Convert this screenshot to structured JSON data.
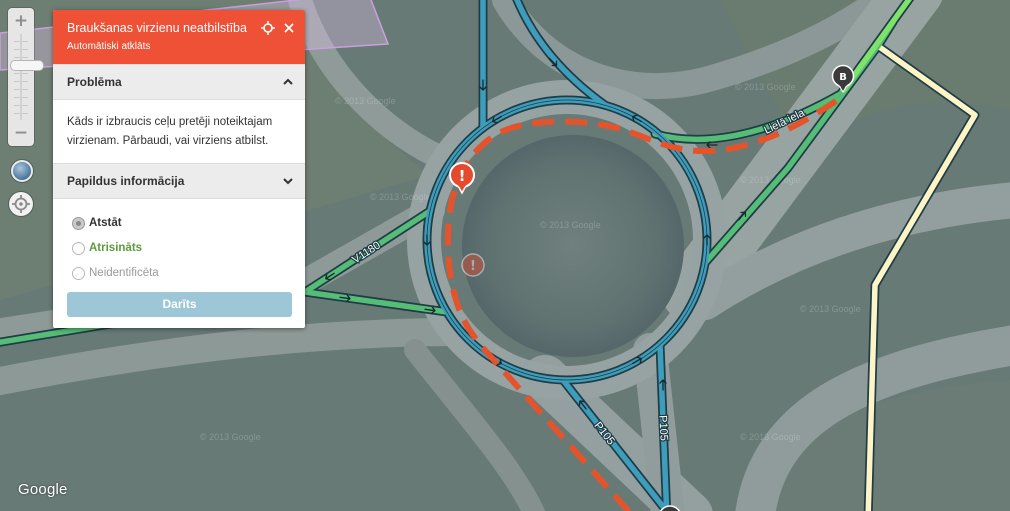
{
  "colors": {
    "panel_header": "#ee5136",
    "section_header_bg": "#ececec",
    "done_button": "#9dc7d6",
    "street_blue": "#3d9dbb",
    "highway_green": "#56bd77",
    "selected_green": "#7fe36b",
    "private_road_cream": "#fff4c6",
    "route_red": "#e3542c",
    "venue_purple": "#c9a0dc"
  },
  "map": {
    "google_logo": "Google",
    "imagery_watermark": "© 2013 Google",
    "road_labels": {
      "v1180": "V1180",
      "liela_iela": "Lielā iela",
      "p105_diagonal": "P105",
      "p105_vertical": "P105"
    },
    "markers": {
      "problem_glyph": "!",
      "end_point": "B"
    }
  },
  "zoom_control": {
    "zoom_in": "+",
    "zoom_out": "−",
    "zoom_level_fraction": 0.64,
    "layer_icon": "layers-globe-icon",
    "locate_icon": "crosshair-icon"
  },
  "problem_panel": {
    "title": "Braukšanas virzienu neatbilstība",
    "subtitle": "Automātiski atklāts",
    "header_icons": {
      "locate": "crosshair-icon",
      "close": "close-icon"
    },
    "sections": [
      {
        "title": "Problēma",
        "chevron": "up",
        "body": "Kāds ir izbraucis ceļu pretēji noteiktajam virzienam. Pārbaudi, vai virziens atbilst."
      },
      {
        "title": "Papildus informācija",
        "chevron": "down"
      }
    ],
    "resolution_options": [
      {
        "label": "Atstāt",
        "selected": true,
        "text_color": "#333333"
      },
      {
        "label": "Atrisināts",
        "selected": false,
        "text_color": "#5b9b3c"
      },
      {
        "label": "Neidentificēta",
        "selected": false,
        "text_color": "#9a9a9a"
      }
    ],
    "done_button": "Darīts"
  }
}
